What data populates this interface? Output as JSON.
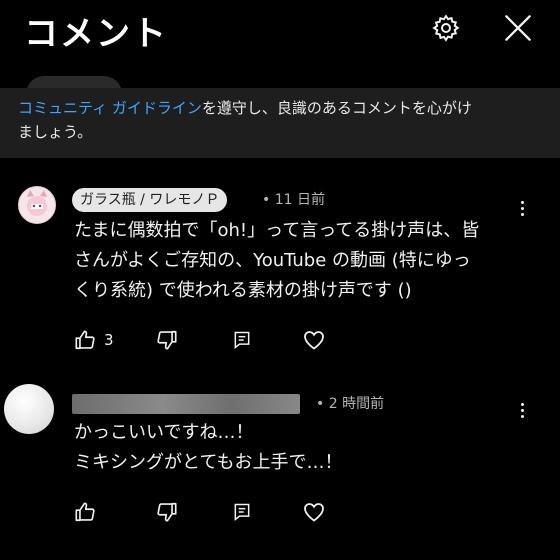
{
  "header": {
    "title": "コメント",
    "settings_icon": "gear-icon",
    "close_icon": "close-icon"
  },
  "banner": {
    "link_text": "コミュニティ ガイドライン",
    "text_line1": "を遵守し、良識のあるコメントを心がけ",
    "text_line2": "ましょう。"
  },
  "comments": [
    {
      "author": "ガラス瓶 / ワレモノＰ",
      "time": "• 11 日前",
      "lines": [
        "たまに偶数拍で「oh!」って言ってる掛け声は、皆",
        "さんがよくご存知の、YouTube の動画 (特にゆっ",
        "くり系統) で使われる素材の掛け声です ()"
      ],
      "likes": "3"
    },
    {
      "author": "",
      "time": "• 2 時間前",
      "lines": [
        "かっこいいですね…！",
        "ミキシングがとてもお上手で…！"
      ],
      "likes": ""
    }
  ],
  "colors": {
    "background": "#000000",
    "banner": "#1e1e1e",
    "link": "#3ea6ff",
    "meta": "#b4b4b4"
  }
}
